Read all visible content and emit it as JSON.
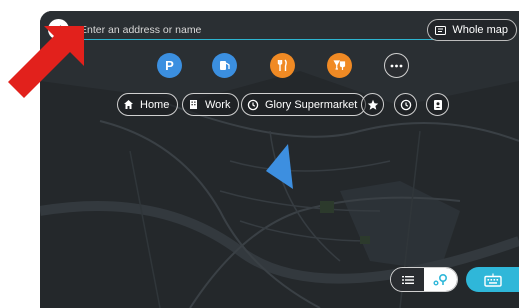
{
  "search": {
    "placeholder": "Enter an address or name"
  },
  "whole_map": {
    "label": "Whole map",
    "icon": "map-icon"
  },
  "poi_buttons": [
    {
      "name": "parking",
      "icon": "P",
      "color": "#3b8fe0"
    },
    {
      "name": "fuel",
      "icon": "fuel-icon",
      "color": "#3b8fe0"
    },
    {
      "name": "restaurant",
      "icon": "cutlery-icon",
      "color": "#f08a24"
    },
    {
      "name": "bar",
      "icon": "drinks-icon",
      "color": "#f08a24"
    },
    {
      "name": "more",
      "icon": "ellipsis-icon",
      "color": "#2a2d31"
    }
  ],
  "shortcuts": {
    "home": "Home",
    "work": "Work",
    "recent": "Glory Supermarket"
  },
  "shortcut_icons": [
    "star-icon",
    "history-icon",
    "contacts-icon"
  ],
  "colors": {
    "accent": "#2db4cf",
    "orange": "#f08a24",
    "blue": "#3b8fe0",
    "arrow": "#e2211c",
    "map_bg": "#202427"
  }
}
